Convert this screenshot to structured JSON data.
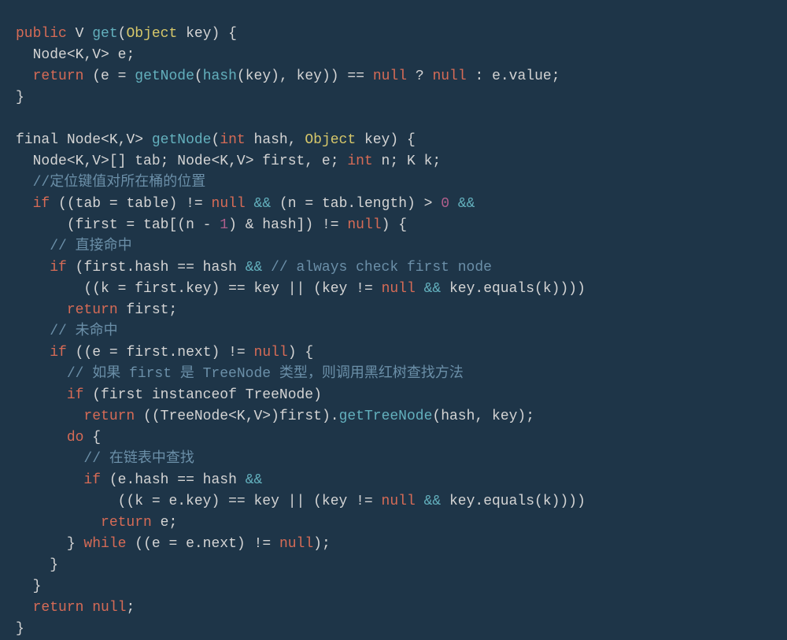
{
  "code": {
    "l1": {
      "public": "public",
      "V": "V",
      "get": "get",
      "lp": "(",
      "Object": "Object",
      "key": " key",
      "rp": ")",
      "lb": " {"
    },
    "l2": {
      "indent": "  ",
      "node": "Node",
      "gen": "<K,V>",
      "e": " e;"
    },
    "l3": {
      "indent": "  ",
      "return": "return",
      "sp": " ",
      "lp": "(",
      "eeq": "e = ",
      "getNode": "getNode",
      "lp2": "(",
      "hash": "hash",
      "lp3": "(",
      "key1": "key",
      "rp3": ")",
      "comma": ", ",
      "key2": "key",
      "rp2": ")",
      "rp": ")",
      "eqeq": " == ",
      "null1": "null",
      "q": " ? ",
      "null2": "null",
      "colon": " : ",
      "edot": "e.",
      "value": "value",
      "semi": ";"
    },
    "l4": {
      "brace": "}"
    },
    "l5": {
      "blank": ""
    },
    "l6": {
      "final": "final",
      "sp": " ",
      "node": "Node",
      "gen": "<K,V>",
      "sp2": " ",
      "getNode": "getNode",
      "lp": "(",
      "int": "int",
      "hash": " hash, ",
      "Object": "Object",
      "key": " key",
      "rp": ")",
      "lb": " {"
    },
    "l7": {
      "indent": "  ",
      "node1": "Node",
      "gen1": "<K,V>",
      "arr": "[] ",
      "tab": "tab; ",
      "node2": "Node",
      "gen2": "<K,V>",
      "rest": " first, e; ",
      "int": "int",
      "n": " n; ",
      "K": "K",
      "k": " k;"
    },
    "l8": {
      "indent": "  ",
      "comment": "//定位键值对所在桶的位置"
    },
    "l9": {
      "indent": "  ",
      "if": "if",
      "sp": " ",
      "lp": "(",
      "lp2": "(",
      "tabeq": "tab = table",
      "rp2": ")",
      "ne": " != ",
      "null": "null",
      "andand": " && ",
      "lp3": "(",
      "neq": "n = tab.length",
      "rp3": ")",
      "gt": " > ",
      "zero": "0",
      "andand2": " &&"
    },
    "l10": {
      "indent": "      ",
      "lp": "(",
      "firsteq": "first = tab[",
      "lp2": "(",
      "nminus": "n - ",
      "one": "1",
      "rp2": ")",
      "amphash": " & hash]",
      "rp": ")",
      "ne": " != ",
      "null": "null",
      "rp3": ")",
      "lb": " {"
    },
    "l11": {
      "indent": "    ",
      "comment": "// 直接命中"
    },
    "l12": {
      "indent": "    ",
      "if": "if",
      "sp": " ",
      "lp": "(",
      "firsthash": "first.hash == hash ",
      "andand": "&&",
      "sp2": " ",
      "comment": "// always check first node"
    },
    "l13": {
      "indent": "        ",
      "lp": "(",
      "lp2": "(",
      "keq": "k = first.key",
      "rp2": ")",
      "eqeq": " == key || ",
      "lp3": "(",
      "keyne": "key != ",
      "null": "null",
      "andand": " && ",
      "keyeq": "key.equals",
      "lp4": "(",
      "k": "k",
      "rp4": ")",
      "rp3": ")",
      "rp": ")",
      "rp5": ")"
    },
    "l14": {
      "indent": "      ",
      "return": "return",
      "first": " first;"
    },
    "l15": {
      "indent": "    ",
      "comment": "// 未命中"
    },
    "l16": {
      "indent": "    ",
      "if": "if",
      "sp": " ",
      "lp": "(",
      "lp2": "(",
      "eeq": "e = first.next",
      "rp2": ")",
      "ne": " != ",
      "null": "null",
      "rp": ")",
      "lb": " {"
    },
    "l17": {
      "indent": "      ",
      "comment": "// 如果 first 是 TreeNode 类型，则调用黑红树查找方法"
    },
    "l18": {
      "indent": "      ",
      "if": "if",
      "sp": " ",
      "lp": "(",
      "first": "first ",
      "instanceof": "instanceof",
      "treenode": " TreeNode",
      "rp": ")"
    },
    "l19": {
      "indent": "        ",
      "return": "return",
      "sp": " ",
      "lp": "(",
      "lp2": "(",
      "treenode": "TreeNode",
      "gen": "<K,V>",
      "rp2": ")",
      "first": "first",
      "rp": ")",
      "dot": ".",
      "gettreenode": "getTreeNode",
      "lp3": "(",
      "args": "hash, key",
      "rp3": ")",
      "semi": ";"
    },
    "l20": {
      "indent": "      ",
      "do": "do",
      "lb": " {"
    },
    "l21": {
      "indent": "        ",
      "comment": "// 在链表中查找"
    },
    "l22": {
      "indent": "        ",
      "if": "if",
      "sp": " ",
      "lp": "(",
      "ehash": "e.hash == hash ",
      "andand": "&&"
    },
    "l23": {
      "indent": "            ",
      "lp": "(",
      "lp2": "(",
      "keq": "k = e.key",
      "rp2": ")",
      "eqeq": " == key || ",
      "lp3": "(",
      "keyne": "key != ",
      "null": "null",
      "andand": " && ",
      "keyeq": "key.equals",
      "lp4": "(",
      "k": "k",
      "rp4": ")",
      "rp3": ")",
      "rp": ")",
      "rp5": ")"
    },
    "l24": {
      "indent": "          ",
      "return": "return",
      "e": " e;"
    },
    "l25": {
      "indent": "      ",
      "brace": "} ",
      "while": "while",
      "sp": " ",
      "lp": "(",
      "lp2": "(",
      "eeq": "e = e.next",
      "rp2": ")",
      "ne": " != ",
      "null": "null",
      "rp": ")",
      "semi": ";"
    },
    "l26": {
      "indent": "    ",
      "brace": "}"
    },
    "l27": {
      "indent": "  ",
      "brace": "}"
    },
    "l28": {
      "indent": "  ",
      "return": "return",
      "sp": " ",
      "null": "null",
      "semi": ";"
    },
    "l29": {
      "brace": "}"
    }
  }
}
